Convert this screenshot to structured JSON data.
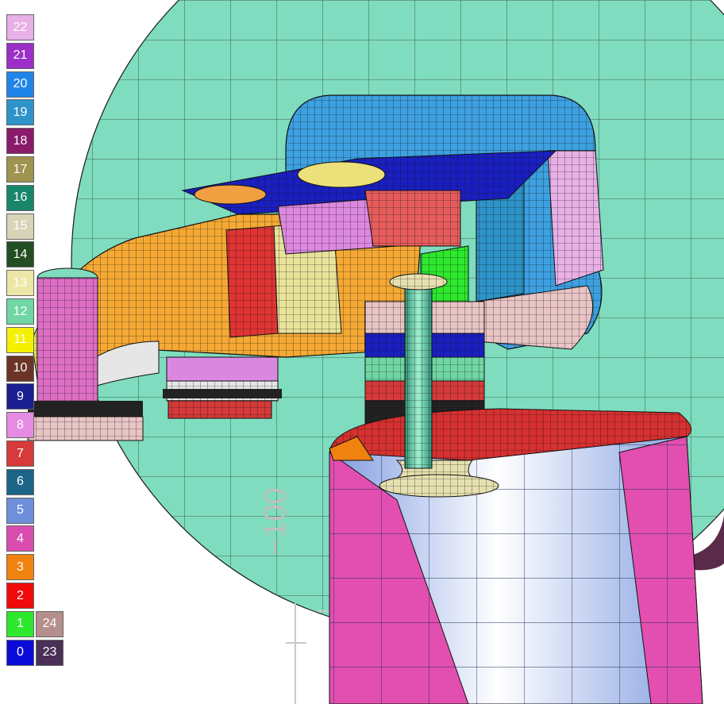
{
  "viewport": {
    "axis_label": "−100",
    "colors": {
      "background_sphere": "#7fdcbf",
      "mesh_line": "#1a1a1a",
      "cylinder_blue": "#9fb9ee",
      "cylinder_pink": "#e24fb0",
      "piston_top": "#d63030"
    }
  },
  "legend": {
    "swatches": [
      {
        "label": "22",
        "color": "#e7b0e6",
        "text_color": "#ffffff"
      },
      {
        "label": "21",
        "color": "#9b2fc8",
        "text_color": "#ffffff"
      },
      {
        "label": "20",
        "color": "#1f85e8",
        "text_color": "#ffffff"
      },
      {
        "label": "19",
        "color": "#2d93c8",
        "text_color": "#ffffff"
      },
      {
        "label": "18",
        "color": "#8a1b6a",
        "text_color": "#ffffff"
      },
      {
        "label": "17",
        "color": "#a0924f",
        "text_color": "#ffffff"
      },
      {
        "label": "16",
        "color": "#17866a",
        "text_color": "#ffffff"
      },
      {
        "label": "15",
        "color": "#d8d4b8",
        "text_color": "#ffffff"
      },
      {
        "label": "14",
        "color": "#234d23",
        "text_color": "#ffffff"
      },
      {
        "label": "13",
        "color": "#ece7a6",
        "text_color": "#ffffff"
      },
      {
        "label": "12",
        "color": "#6fd6a4",
        "text_color": "#ffffff"
      },
      {
        "label": "11",
        "color": "#f5f000",
        "text_color": "#ffffff"
      },
      {
        "label": "10",
        "color": "#6a3528",
        "text_color": "#ffffff"
      },
      {
        "label": "9",
        "color": "#1a1f8f",
        "text_color": "#ffffff"
      },
      {
        "label": "8",
        "color": "#e58be3",
        "text_color": "#ffffff"
      },
      {
        "label": "7",
        "color": "#d63a3a",
        "text_color": "#ffffff"
      },
      {
        "label": "6",
        "color": "#1d6588",
        "text_color": "#ffffff"
      },
      {
        "label": "5",
        "color": "#6e8fdb",
        "text_color": "#ffffff"
      },
      {
        "label": "4",
        "color": "#d94cb0",
        "text_color": "#ffffff"
      },
      {
        "label": "3",
        "color": "#f08210",
        "text_color": "#ffffff"
      },
      {
        "label": "2",
        "color": "#f00a0a",
        "text_color": "#ffffff"
      },
      {
        "label": "1",
        "color": "#2de82d",
        "text_color": "#ffffff"
      },
      {
        "label": "0",
        "color": "#0b0bd9",
        "text_color": "#ffffff"
      }
    ],
    "extra_swatches": [
      {
        "label": "24",
        "color": "#b48f8c",
        "text_color": "#ffffff"
      },
      {
        "label": "23",
        "color": "#4a3056",
        "text_color": "#ffffff"
      }
    ]
  }
}
